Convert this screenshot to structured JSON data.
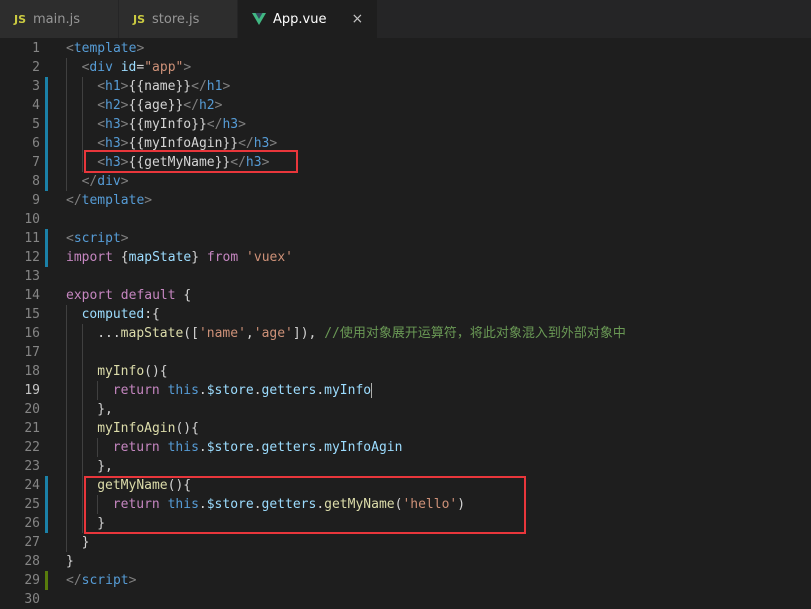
{
  "tabs": [
    {
      "icon": "JS",
      "label": "main.js",
      "active": false
    },
    {
      "icon": "JS",
      "label": "store.js",
      "active": false
    },
    {
      "icon": "vue",
      "label": "App.vue",
      "active": true,
      "close": "×"
    }
  ],
  "colors": {
    "background": "#1e1e1e",
    "tab_active": "#1e1e1e",
    "tab_inactive": "#2d2d2d",
    "highlight": "#e8363b",
    "modified_gutter": "#1b81a8",
    "added_gutter": "#587c0c"
  },
  "editor": {
    "current_line": 19,
    "lines": [
      {
        "n": "1",
        "indent": 0,
        "gutter": "",
        "tokens": [
          [
            "t-pun",
            "<"
          ],
          [
            "t-tag",
            "template"
          ],
          [
            "t-pun",
            ">"
          ]
        ]
      },
      {
        "n": "2",
        "indent": 1,
        "gutter": "",
        "tokens": [
          [
            "t-pun",
            "<"
          ],
          [
            "t-tag",
            "div"
          ],
          [
            "t-txt",
            " "
          ],
          [
            "t-attr",
            "id"
          ],
          [
            "t-txt",
            "="
          ],
          [
            "t-str",
            "\"app\""
          ],
          [
            "t-pun",
            ">"
          ]
        ]
      },
      {
        "n": "3",
        "indent": 2,
        "gutter": "mod",
        "tokens": [
          [
            "t-pun",
            "<"
          ],
          [
            "t-tag",
            "h1"
          ],
          [
            "t-pun",
            ">"
          ],
          [
            "t-txt",
            "{{name}}"
          ],
          [
            "t-pun",
            "</"
          ],
          [
            "t-tag",
            "h1"
          ],
          [
            "t-pun",
            ">"
          ]
        ]
      },
      {
        "n": "4",
        "indent": 2,
        "gutter": "mod",
        "tokens": [
          [
            "t-pun",
            "<"
          ],
          [
            "t-tag",
            "h2"
          ],
          [
            "t-pun",
            ">"
          ],
          [
            "t-txt",
            "{{age}}"
          ],
          [
            "t-pun",
            "</"
          ],
          [
            "t-tag",
            "h2"
          ],
          [
            "t-pun",
            ">"
          ]
        ]
      },
      {
        "n": "5",
        "indent": 2,
        "gutter": "mod",
        "tokens": [
          [
            "t-pun",
            "<"
          ],
          [
            "t-tag",
            "h3"
          ],
          [
            "t-pun",
            ">"
          ],
          [
            "t-txt",
            "{{myInfo}}"
          ],
          [
            "t-pun",
            "</"
          ],
          [
            "t-tag",
            "h3"
          ],
          [
            "t-pun",
            ">"
          ]
        ]
      },
      {
        "n": "6",
        "indent": 2,
        "gutter": "mod",
        "tokens": [
          [
            "t-pun",
            "<"
          ],
          [
            "t-tag",
            "h3"
          ],
          [
            "t-pun",
            ">"
          ],
          [
            "t-txt",
            "{{myInfoAgin}}"
          ],
          [
            "t-pun",
            "</"
          ],
          [
            "t-tag",
            "h3"
          ],
          [
            "t-pun",
            ">"
          ]
        ]
      },
      {
        "n": "7",
        "indent": 2,
        "gutter": "mod",
        "tokens": [
          [
            "t-pun",
            "<"
          ],
          [
            "t-tag",
            "h3"
          ],
          [
            "t-pun",
            ">"
          ],
          [
            "t-txt",
            "{{getMyName}}"
          ],
          [
            "t-pun",
            "</"
          ],
          [
            "t-tag",
            "h3"
          ],
          [
            "t-pun",
            ">"
          ]
        ]
      },
      {
        "n": "8",
        "indent": 1,
        "gutter": "mod",
        "tokens": [
          [
            "t-pun",
            "</"
          ],
          [
            "t-tag",
            "div"
          ],
          [
            "t-pun",
            ">"
          ]
        ]
      },
      {
        "n": "9",
        "indent": 0,
        "gutter": "",
        "tokens": [
          [
            "t-pun",
            "</"
          ],
          [
            "t-tag",
            "template"
          ],
          [
            "t-pun",
            ">"
          ]
        ]
      },
      {
        "n": "10",
        "indent": 0,
        "gutter": "",
        "tokens": []
      },
      {
        "n": "11",
        "indent": 0,
        "gutter": "mod",
        "tokens": [
          [
            "t-pun",
            "<"
          ],
          [
            "t-tag",
            "script"
          ],
          [
            "t-pun",
            ">"
          ]
        ]
      },
      {
        "n": "12",
        "indent": 0,
        "gutter": "mod",
        "tokens": [
          [
            "t-ctl",
            "import"
          ],
          [
            "t-txt",
            " {"
          ],
          [
            "t-var",
            "mapState"
          ],
          [
            "t-txt",
            "} "
          ],
          [
            "t-ctl",
            "from"
          ],
          [
            "t-txt",
            " "
          ],
          [
            "t-str",
            "'vuex'"
          ]
        ]
      },
      {
        "n": "13",
        "indent": 0,
        "gutter": "",
        "tokens": []
      },
      {
        "n": "14",
        "indent": 0,
        "gutter": "",
        "tokens": [
          [
            "t-ctl",
            "export"
          ],
          [
            "t-txt",
            " "
          ],
          [
            "t-ctl",
            "default"
          ],
          [
            "t-txt",
            " {"
          ]
        ]
      },
      {
        "n": "15",
        "indent": 1,
        "gutter": "",
        "tokens": [
          [
            "t-var",
            "computed"
          ],
          [
            "t-txt",
            ":{"
          ]
        ]
      },
      {
        "n": "16",
        "indent": 2,
        "gutter": "",
        "tokens": [
          [
            "t-txt",
            "..."
          ],
          [
            "t-fn",
            "mapState"
          ],
          [
            "t-txt",
            "(["
          ],
          [
            "t-str",
            "'name'"
          ],
          [
            "t-txt",
            ","
          ],
          [
            "t-str",
            "'age'"
          ],
          [
            "t-txt",
            "]), "
          ],
          [
            "t-cmt",
            "//使用对象展开运算符，将此对象混入到外部对象中"
          ]
        ]
      },
      {
        "n": "17",
        "indent": 2,
        "gutter": "",
        "tokens": []
      },
      {
        "n": "18",
        "indent": 2,
        "gutter": "",
        "tokens": [
          [
            "t-fn",
            "myInfo"
          ],
          [
            "t-txt",
            "(){"
          ]
        ]
      },
      {
        "n": "19",
        "indent": 3,
        "gutter": "",
        "cursor": true,
        "tokens": [
          [
            "t-ctl",
            "return"
          ],
          [
            "t-txt",
            " "
          ],
          [
            "t-kw",
            "this"
          ],
          [
            "t-txt",
            "."
          ],
          [
            "t-var",
            "$store"
          ],
          [
            "t-txt",
            "."
          ],
          [
            "t-var",
            "getters"
          ],
          [
            "t-txt",
            "."
          ],
          [
            "t-var",
            "myInfo"
          ]
        ]
      },
      {
        "n": "20",
        "indent": 2,
        "gutter": "",
        "tokens": [
          [
            "t-txt",
            "},"
          ]
        ]
      },
      {
        "n": "21",
        "indent": 2,
        "gutter": "",
        "tokens": [
          [
            "t-fn",
            "myInfoAgin"
          ],
          [
            "t-txt",
            "(){"
          ]
        ]
      },
      {
        "n": "22",
        "indent": 3,
        "gutter": "",
        "tokens": [
          [
            "t-ctl",
            "return"
          ],
          [
            "t-txt",
            " "
          ],
          [
            "t-kw",
            "this"
          ],
          [
            "t-txt",
            "."
          ],
          [
            "t-var",
            "$store"
          ],
          [
            "t-txt",
            "."
          ],
          [
            "t-var",
            "getters"
          ],
          [
            "t-txt",
            "."
          ],
          [
            "t-var",
            "myInfoAgin"
          ]
        ]
      },
      {
        "n": "23",
        "indent": 2,
        "gutter": "",
        "tokens": [
          [
            "t-txt",
            "},"
          ]
        ]
      },
      {
        "n": "24",
        "indent": 2,
        "gutter": "mod",
        "tokens": [
          [
            "t-fn",
            "getMyName"
          ],
          [
            "t-txt",
            "(){"
          ]
        ]
      },
      {
        "n": "25",
        "indent": 3,
        "gutter": "mod",
        "tokens": [
          [
            "t-ctl",
            "return"
          ],
          [
            "t-txt",
            " "
          ],
          [
            "t-kw",
            "this"
          ],
          [
            "t-txt",
            "."
          ],
          [
            "t-var",
            "$store"
          ],
          [
            "t-txt",
            "."
          ],
          [
            "t-var",
            "getters"
          ],
          [
            "t-txt",
            "."
          ],
          [
            "t-fn",
            "getMyName"
          ],
          [
            "t-txt",
            "("
          ],
          [
            "t-str",
            "'hello'"
          ],
          [
            "t-txt",
            ")"
          ]
        ]
      },
      {
        "n": "26",
        "indent": 2,
        "gutter": "mod",
        "tokens": [
          [
            "t-txt",
            "}"
          ]
        ]
      },
      {
        "n": "27",
        "indent": 1,
        "gutter": "",
        "tokens": [
          [
            "t-txt",
            "}"
          ]
        ]
      },
      {
        "n": "28",
        "indent": 0,
        "gutter": "",
        "tokens": [
          [
            "t-txt",
            "}"
          ]
        ]
      },
      {
        "n": "29",
        "indent": 0,
        "gutter": "add",
        "tokens": [
          [
            "t-pun",
            "</"
          ],
          [
            "t-tag",
            "script"
          ],
          [
            "t-pun",
            ">"
          ]
        ]
      },
      {
        "n": "30",
        "indent": 0,
        "gutter": "",
        "tokens": []
      }
    ]
  }
}
